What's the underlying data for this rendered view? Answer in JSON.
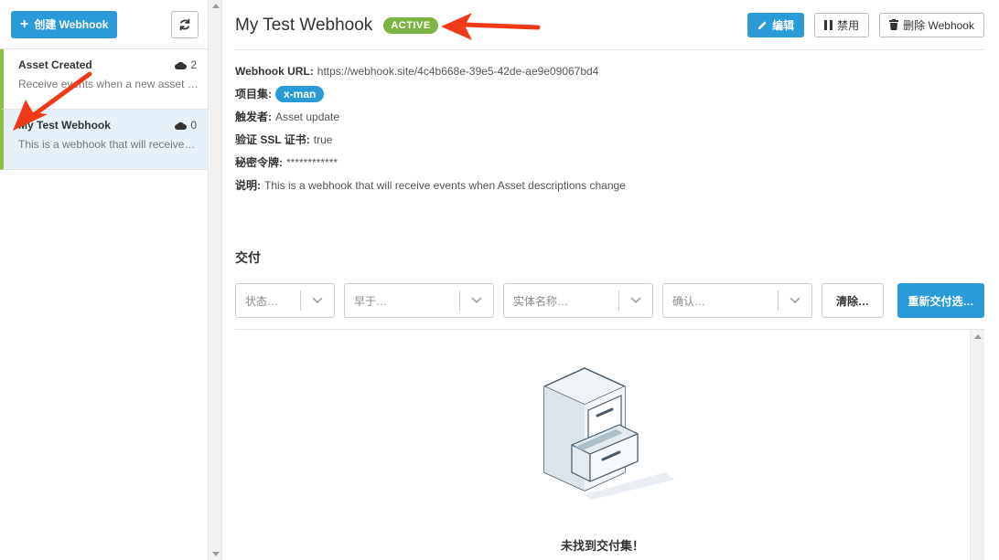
{
  "sidebar": {
    "create_button": "创建 Webhook",
    "items": [
      {
        "name": "Asset Created",
        "count": "2",
        "desc": "Receive events when a new asset …"
      },
      {
        "name": "My Test Webhook",
        "count": "0",
        "desc": "This is a webhook that will receive…"
      }
    ]
  },
  "header": {
    "title": "My Test Webhook",
    "status": "ACTIVE",
    "edit_label": "编辑",
    "disable_label": "禁用",
    "delete_label": "删除 Webhook"
  },
  "details": {
    "url_label": "Webhook URL:",
    "url_value": "https://webhook.site/4c4b668e-39e5-42de-ae9e09067bd4",
    "project_label": "项目集:",
    "project_tag": "x-man",
    "trigger_label": "触发者:",
    "trigger_value": "Asset update",
    "ssl_label": "验证 SSL 证书:",
    "ssl_value": "true",
    "secret_label": "秘密令牌:",
    "secret_value": "************",
    "desc_label": "说明:",
    "desc_value": "This is a webhook that will receive events when Asset descriptions change"
  },
  "deliveries": {
    "title": "交付",
    "filters": {
      "status": "状态…",
      "before": "早于…",
      "entity": "实体名称…",
      "ack": "确认…"
    },
    "clear_label": "清除…",
    "redeliver_label": "重新交付选…",
    "empty_text": "未找到交付集！"
  },
  "colors": {
    "primary": "#2b9ad8",
    "active": "#7cb342",
    "accent_border": "#8dbf42",
    "annotation": "#f03a17"
  }
}
